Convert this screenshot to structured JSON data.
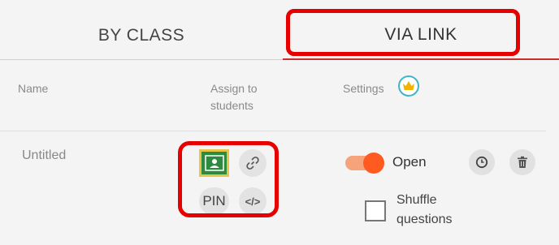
{
  "tabs": [
    {
      "label": "BY CLASS",
      "active": false
    },
    {
      "label": "VIA LINK",
      "active": true
    }
  ],
  "columns": {
    "name": "Name",
    "assign": "Assign to students",
    "assign_line1": "Assign to",
    "assign_line2": "students",
    "settings": "Settings"
  },
  "row": {
    "name": "Untitled",
    "share": {
      "pin_label": "PIN",
      "embed_label": "</>"
    },
    "settings": {
      "toggle_label": "Open",
      "toggle_on": true,
      "shuffle_line1": "Shuffle",
      "shuffle_line2": "questions",
      "shuffle_checked": false
    }
  },
  "icons": [
    "crown-icon",
    "google-classroom-icon",
    "link-icon",
    "clock-icon",
    "trash-icon"
  ],
  "colors": {
    "highlight": "#e60000",
    "active_tab_underline": "#c9302c",
    "toggle": "#ff5a1f",
    "classroom_green": "#2d8a3e",
    "crown_ring": "#3fb6c8"
  }
}
